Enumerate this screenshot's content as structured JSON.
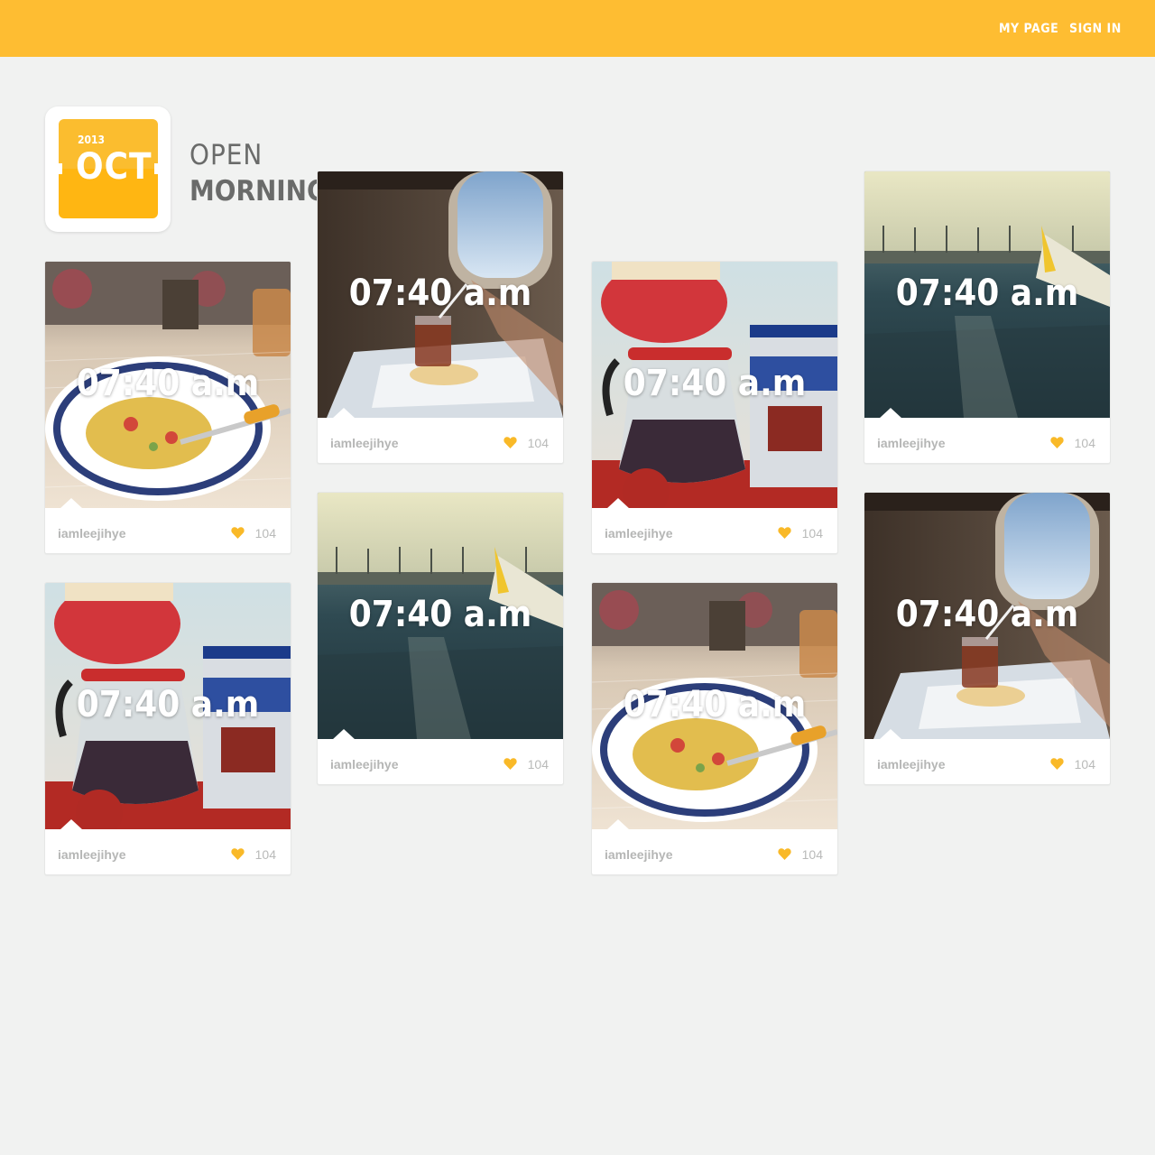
{
  "header": {
    "nav": [
      {
        "label": "MY PAGE"
      },
      {
        "label": "SIGN IN"
      }
    ]
  },
  "logo": {
    "year": "2013",
    "month": "OCT",
    "title_line1": "OPEN",
    "title_line2": "MORNING"
  },
  "colors": {
    "accent": "#febd32",
    "background": "#f1f2f1",
    "heart": "#f9b928"
  },
  "cards": [
    {
      "photo": "breakfast-plate",
      "time": "07:40 a.m",
      "user": "iamleejihye",
      "likes": "104",
      "like_icon": "heart-icon"
    },
    {
      "photo": "airplane-window-drink",
      "time": "07:40 a.m",
      "user": "iamleejihye",
      "likes": "104",
      "like_icon": "heart-icon"
    },
    {
      "photo": "coffee-dripper",
      "time": "07:40 a.m",
      "user": "iamleejihye",
      "likes": "104",
      "like_icon": "heart-icon"
    },
    {
      "photo": "airport-tarmac",
      "time": "07:40 a.m",
      "user": "iamleejihye",
      "likes": "104",
      "like_icon": "heart-icon"
    },
    {
      "photo": "coffee-dripper",
      "time": "07:40 a.m",
      "user": "iamleejihye",
      "likes": "104",
      "like_icon": "heart-icon"
    },
    {
      "photo": "airport-tarmac",
      "time": "07:40 a.m",
      "user": "iamleejihye",
      "likes": "104",
      "like_icon": "heart-icon"
    },
    {
      "photo": "breakfast-plate",
      "time": "07:40 a.m",
      "user": "iamleejihye",
      "likes": "104",
      "like_icon": "heart-icon"
    },
    {
      "photo": "airplane-window-drink",
      "time": "07:40 a.m",
      "user": "iamleejihye",
      "likes": "104",
      "like_icon": "heart-icon"
    }
  ]
}
